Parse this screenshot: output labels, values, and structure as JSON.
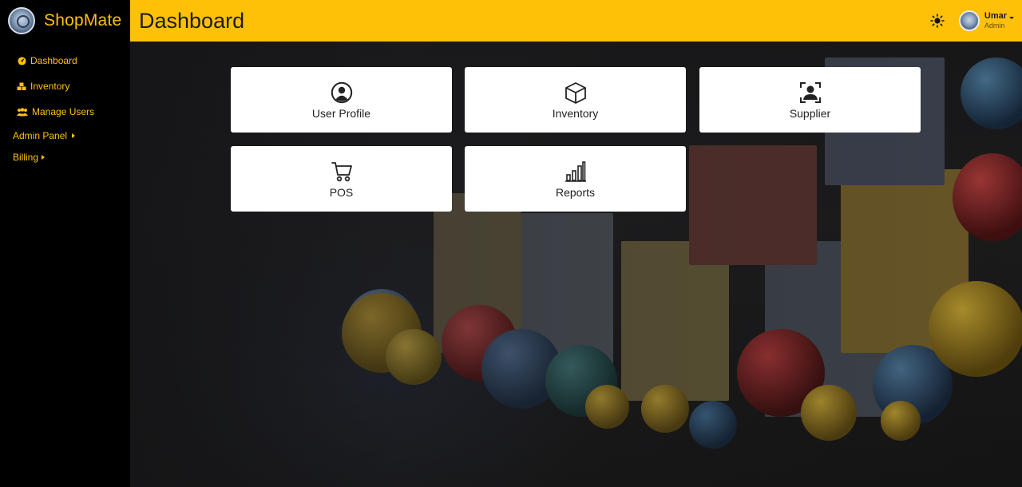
{
  "app": {
    "name": "ShopMate"
  },
  "sidebar": {
    "items": [
      {
        "label": "Dashboard",
        "icon": "gauge-icon"
      },
      {
        "label": "Inventory",
        "icon": "boxes-icon"
      },
      {
        "label": "Manage Users",
        "icon": "users-icon"
      }
    ],
    "groups": [
      {
        "label": "Admin Panel"
      },
      {
        "label": "Billing"
      }
    ]
  },
  "header": {
    "title": "Dashboard",
    "theme_icon": "sun-icon",
    "user": {
      "name": "Umar",
      "role": "Admin"
    }
  },
  "cards": [
    {
      "label": "User Profile",
      "icon": "user-circle-icon"
    },
    {
      "label": "Inventory",
      "icon": "box-icon"
    },
    {
      "label": "Supplier",
      "icon": "person-bounding-icon"
    },
    {
      "label": "POS",
      "icon": "cart-icon"
    },
    {
      "label": "Reports",
      "icon": "bar-chart-icon"
    }
  ],
  "colors": {
    "accent": "#FFC107",
    "sidebar_bg": "#000000",
    "card_bg": "#FFFFFF"
  }
}
